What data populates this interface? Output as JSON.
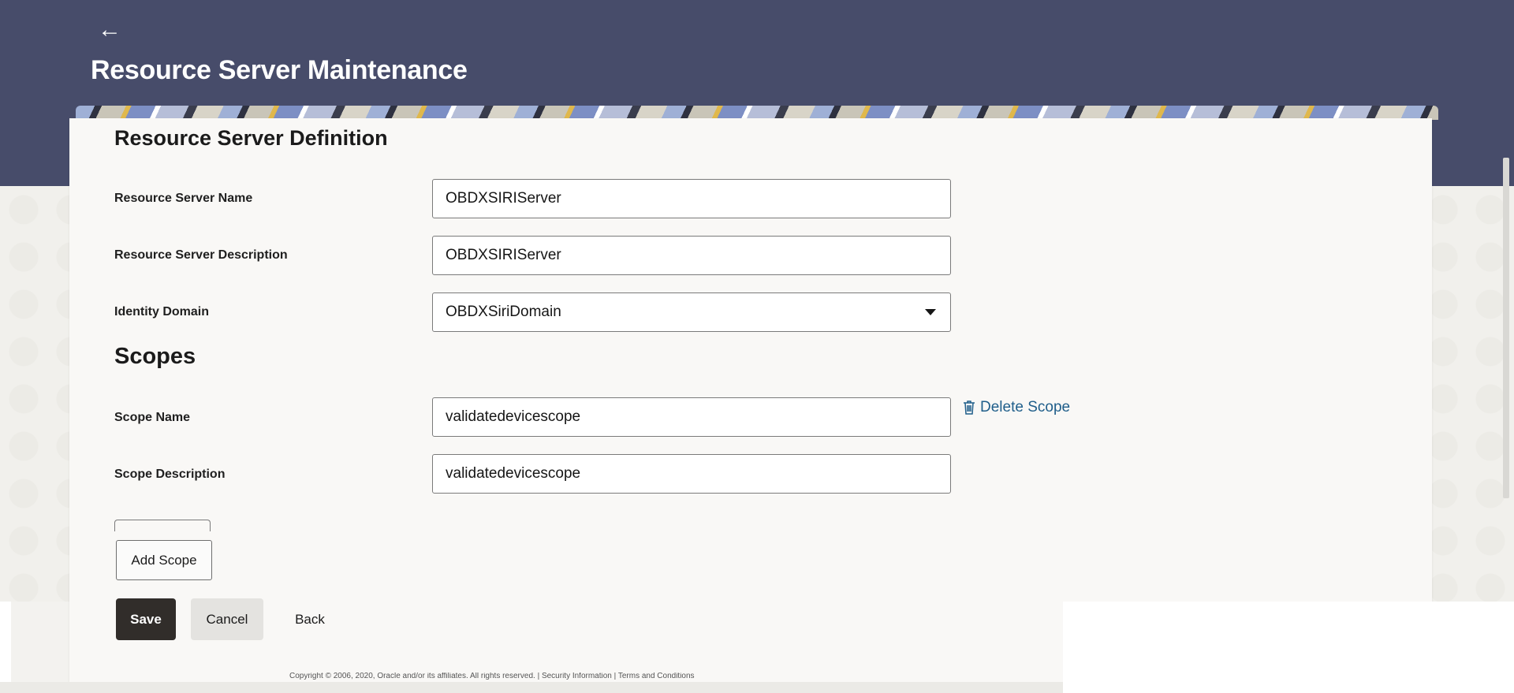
{
  "header": {
    "title": "Resource Server Maintenance",
    "back_icon": "left-arrow-icon"
  },
  "definition": {
    "heading": "Resource Server Definition",
    "name_label": "Resource Server Name",
    "name_value": "OBDXSIRIServer",
    "description_label": "Resource Server Description",
    "description_value": "OBDXSIRIServer",
    "domain_label": "Identity Domain",
    "domain_value": "OBDXSiriDomain"
  },
  "scopes": {
    "heading": "Scopes",
    "scope_name_label": "Scope Name",
    "scope_name_value": "validatedevicescope",
    "scope_description_label": "Scope Description",
    "scope_description_value": "validatedevicescope",
    "delete_label": "Delete Scope",
    "delete_icon": "trash-icon",
    "add_label": "Add Scope"
  },
  "actions": {
    "save": "Save",
    "cancel": "Cancel",
    "back": "Back"
  },
  "footer": {
    "copyright": "Copyright © 2006, 2020, Oracle and/or its affiliates. All rights reserved. | Security Information | Terms and Conditions"
  },
  "colors": {
    "header_bg": "#474c6a",
    "primary_button": "#312d2a",
    "link": "#1f5e8a"
  }
}
